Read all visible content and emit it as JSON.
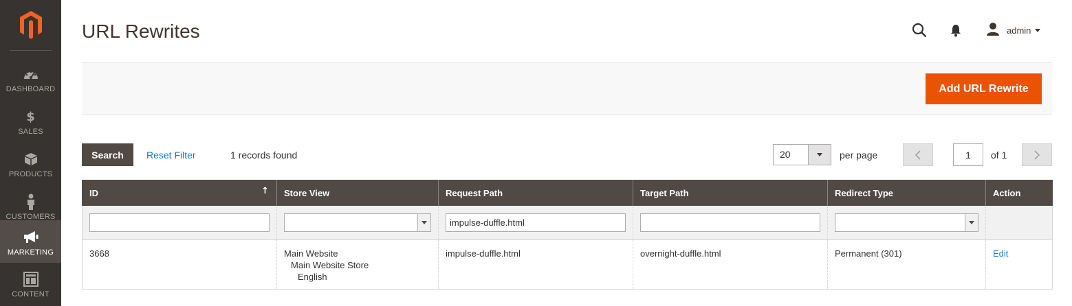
{
  "colors": {
    "accent": "#eb5202",
    "sidebar_bg": "#373330",
    "header_bg": "#514943",
    "link": "#1979c3"
  },
  "sidebar": {
    "logo_icon": "magento-logo-icon",
    "items": [
      {
        "label": "DASHBOARD",
        "icon": "speedometer-icon",
        "active": false
      },
      {
        "label": "SALES",
        "icon": "dollar-icon",
        "active": false
      },
      {
        "label": "PRODUCTS",
        "icon": "box-icon",
        "active": false
      },
      {
        "label": "CUSTOMERS",
        "icon": "person-icon",
        "active": false
      },
      {
        "label": "MARKETING",
        "icon": "megaphone-icon",
        "active": true
      },
      {
        "label": "CONTENT",
        "icon": "layout-icon",
        "active": false
      }
    ]
  },
  "header": {
    "title": "URL Rewrites",
    "user": "admin"
  },
  "action_bar": {
    "add_button": "Add URL Rewrite"
  },
  "toolbar": {
    "search_button": "Search",
    "reset_filter": "Reset Filter",
    "records_found": "1 records found",
    "per_page_value": "20",
    "per_page_label": "per page",
    "current_page": "1",
    "page_of": "of 1"
  },
  "grid": {
    "columns": [
      "ID",
      "Store View",
      "Request Path",
      "Target Path",
      "Redirect Type",
      "Action"
    ],
    "sort_indicator": "↑",
    "filters": {
      "id": "",
      "store_view": "",
      "request_path": "impulse-duffle.html",
      "target_path": "",
      "redirect_type": ""
    },
    "rows": [
      {
        "id": "3668",
        "store_view": [
          "Main Website",
          "Main Website Store",
          "English"
        ],
        "request_path": "impulse-duffle.html",
        "target_path": "overnight-duffle.html",
        "redirect_type": "Permanent (301)",
        "action": "Edit"
      }
    ]
  }
}
